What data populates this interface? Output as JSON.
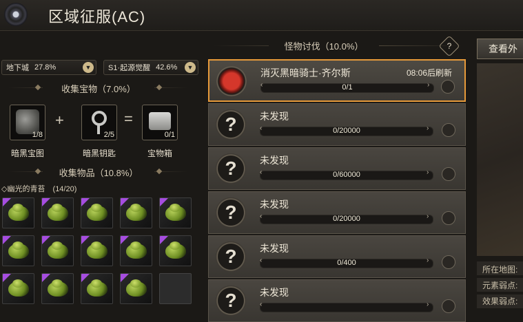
{
  "header": {
    "title": "区域征服(AC)",
    "logo_icon": "eye-orb-icon"
  },
  "dropdowns": [
    {
      "name": "地下城",
      "value": "27.8%"
    },
    {
      "name": "S1·起源觉醒",
      "value": "42.6%"
    }
  ],
  "treasure": {
    "title": "收集宝物（7.0%）",
    "items": [
      {
        "label": "暗黑宝图",
        "count": "1/8",
        "icon": "map-icon"
      },
      {
        "label": "暗黑钥匙",
        "count": "2/5",
        "icon": "key-icon"
      },
      {
        "label": "宝物箱",
        "count": "0/1",
        "icon": "chest-icon"
      }
    ],
    "plus": "+",
    "equals": "="
  },
  "materials": {
    "title": "收集物品（10.8%）",
    "subtitle_prefix": "◇",
    "subtitle_name": "幽光的青苔",
    "subtitle_count": "(14/20)",
    "slots_filled": 14,
    "slots_total": 15
  },
  "monsters": {
    "title": "怪物讨伐（10.0%）",
    "help_label": "?",
    "quests": [
      {
        "name": "消灭黑暗骑士·齐尔斯",
        "timer": "08:06后刷新",
        "progress": "0/1",
        "ratio": 0,
        "active": true,
        "icon": "red-demon-icon"
      },
      {
        "name": "未发现",
        "timer": "",
        "progress": "0/20000",
        "ratio": 0,
        "active": false,
        "icon": "question-mark-icon"
      },
      {
        "name": "未发现",
        "timer": "",
        "progress": "0/60000",
        "ratio": 0,
        "active": false,
        "icon": "question-mark-icon"
      },
      {
        "name": "未发现",
        "timer": "",
        "progress": "0/20000",
        "ratio": 0,
        "active": false,
        "icon": "question-mark-icon"
      },
      {
        "name": "未发现",
        "timer": "",
        "progress": "0/400",
        "ratio": 0,
        "active": false,
        "icon": "question-mark-icon"
      },
      {
        "name": "未发现",
        "timer": "",
        "progress": "",
        "ratio": 0,
        "active": false,
        "icon": "question-mark-icon"
      }
    ]
  },
  "right": {
    "view_button": "查看外",
    "labels": [
      "所在地图:",
      "元素弱点:",
      "效果弱点:"
    ]
  }
}
